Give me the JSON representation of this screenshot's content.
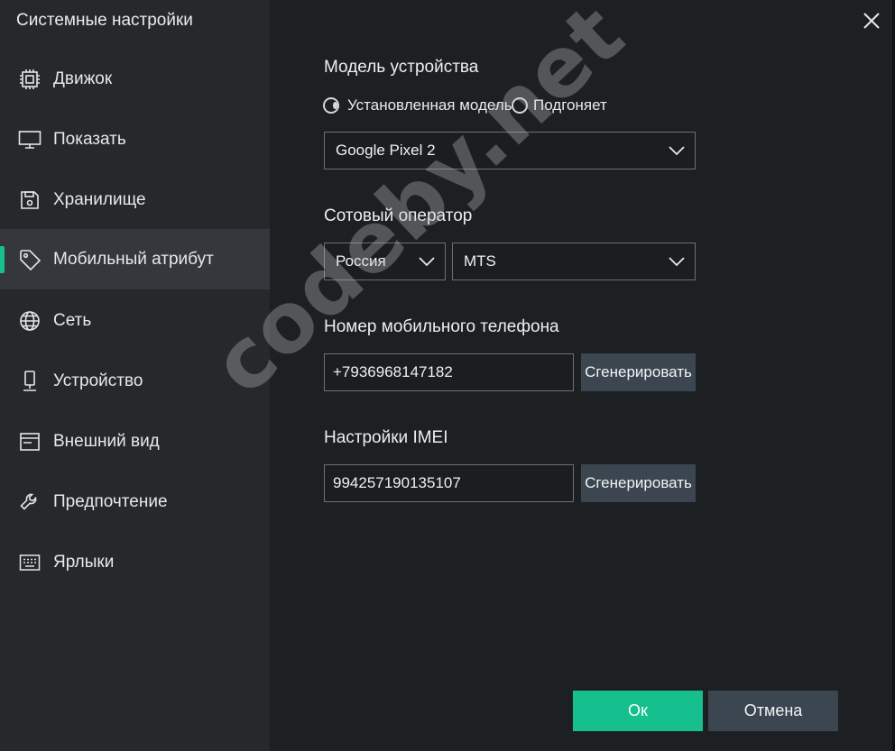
{
  "app": {
    "title": "Системные настройки"
  },
  "sidebar": {
    "items": [
      {
        "label": "Движок",
        "icon": "cpu-icon"
      },
      {
        "label": "Показать",
        "icon": "monitor-icon"
      },
      {
        "label": "Хранилище",
        "icon": "save-icon"
      },
      {
        "label": "Мобильный атрибут",
        "icon": "tag-icon",
        "active": true
      },
      {
        "label": "Сеть",
        "icon": "globe-icon"
      },
      {
        "label": "Устройство",
        "icon": "device-icon"
      },
      {
        "label": "Внешний вид",
        "icon": "window-icon"
      },
      {
        "label": "Предпочтение",
        "icon": "wrench-icon"
      },
      {
        "label": "Ярлыки",
        "icon": "keyboard-icon"
      }
    ]
  },
  "device_model": {
    "title": "Модель устройства",
    "radio_installed": "Установленная модель",
    "radio_custom": "Подгоняет",
    "selected": "installed",
    "model_value": "Google Pixel 2"
  },
  "carrier": {
    "title": "Сотовый оператор",
    "country_value": "Россия",
    "operator_value": "MTS"
  },
  "phone": {
    "title": "Номер мобильного телефона",
    "value": "+7936968147182",
    "generate_label": "Сгенерировать"
  },
  "imei": {
    "title": "Настройки IMEI",
    "value": "994257190135107",
    "generate_label": "Сгенерировать"
  },
  "footer": {
    "ok_label": "Ок",
    "cancel_label": "Отмена"
  },
  "watermark": "codeby.net",
  "colors": {
    "accent": "#16c08e",
    "sidebar": "#26292c",
    "background": "#1d2023",
    "button": "#3b4650"
  }
}
